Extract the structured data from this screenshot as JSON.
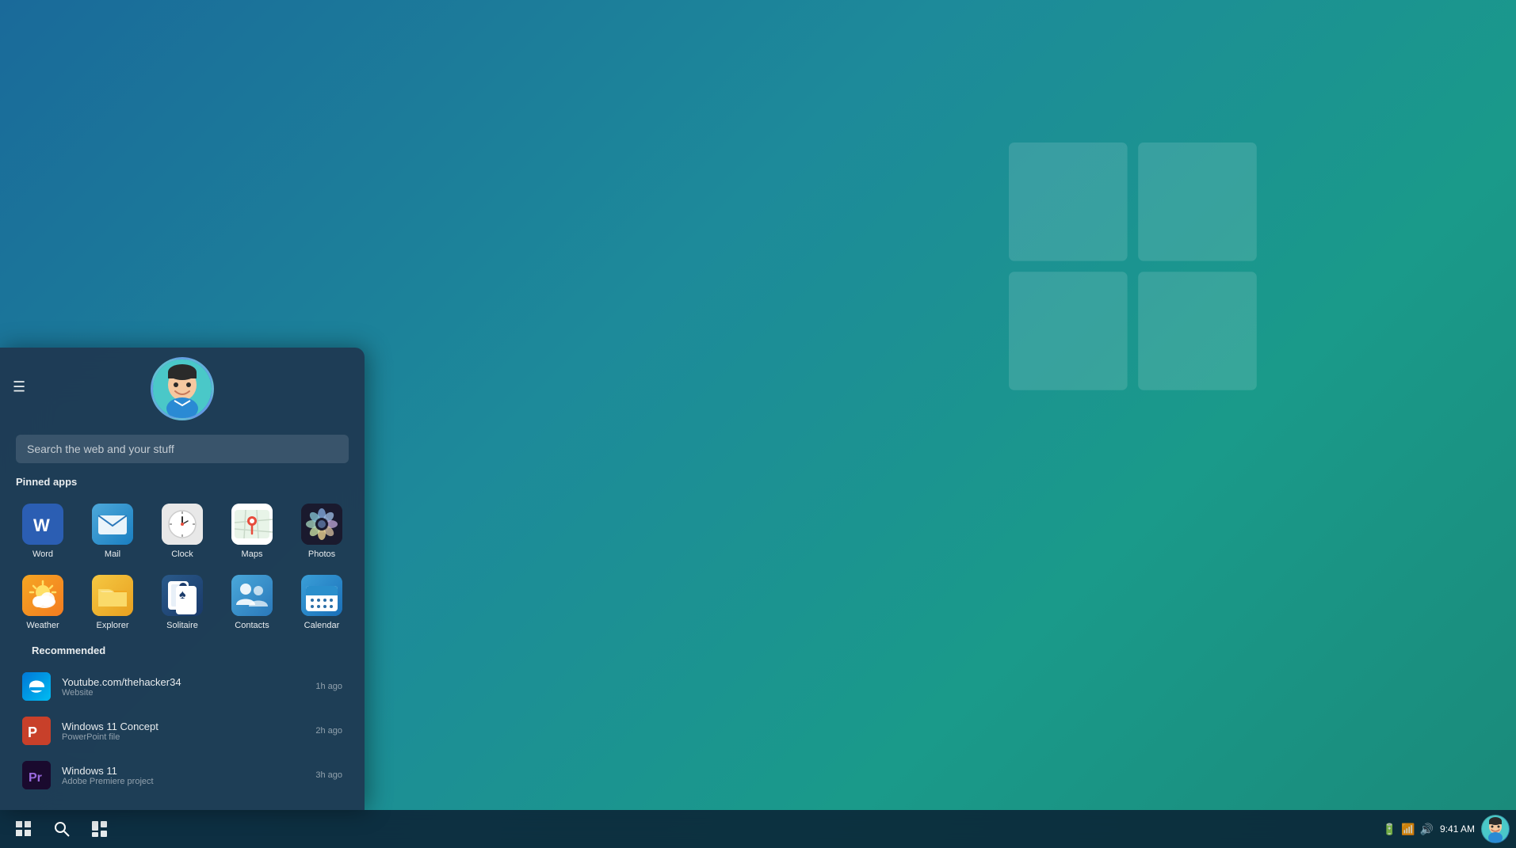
{
  "desktop": {
    "background": "teal-blue gradient"
  },
  "taskbar": {
    "time": "9:41 AM",
    "start_label": "⊞",
    "search_label": "🔍",
    "task_view_label": "⧉"
  },
  "start_menu": {
    "hamburger": "☰",
    "search_placeholder": "Search the web and your stuff",
    "pinned_label": "Pinned apps",
    "recommended_label": "Recommended",
    "pinned_apps": [
      {
        "id": "word",
        "label": "Word",
        "icon_text": "W"
      },
      {
        "id": "mail",
        "label": "Mail",
        "icon_text": "✉"
      },
      {
        "id": "clock",
        "label": "Clock",
        "icon_text": "🕐"
      },
      {
        "id": "maps",
        "label": "Maps",
        "icon_text": "📍"
      },
      {
        "id": "photos",
        "label": "Photos",
        "icon_text": "🖼"
      },
      {
        "id": "weather",
        "label": "Weather",
        "icon_text": "☀"
      },
      {
        "id": "explorer",
        "label": "Explorer",
        "icon_text": "📁"
      },
      {
        "id": "solitaire",
        "label": "Solitaire",
        "icon_text": "♠"
      },
      {
        "id": "contacts",
        "label": "Contacts",
        "icon_text": "👥"
      },
      {
        "id": "calendar",
        "label": "Calendar",
        "icon_text": "📅"
      }
    ],
    "recommended": [
      {
        "id": "youtube",
        "title": "Youtube.com/thehacker34",
        "subtitle": "Website",
        "time": "1h ago",
        "icon": "edge"
      },
      {
        "id": "win11concept",
        "title": "Windows 11 Concept",
        "subtitle": "PowerPoint file",
        "time": "2h ago",
        "icon": "ppt"
      },
      {
        "id": "win11",
        "title": "Windows 11",
        "subtitle": "Adobe Premiere project",
        "time": "3h ago",
        "icon": "premiere"
      }
    ]
  }
}
